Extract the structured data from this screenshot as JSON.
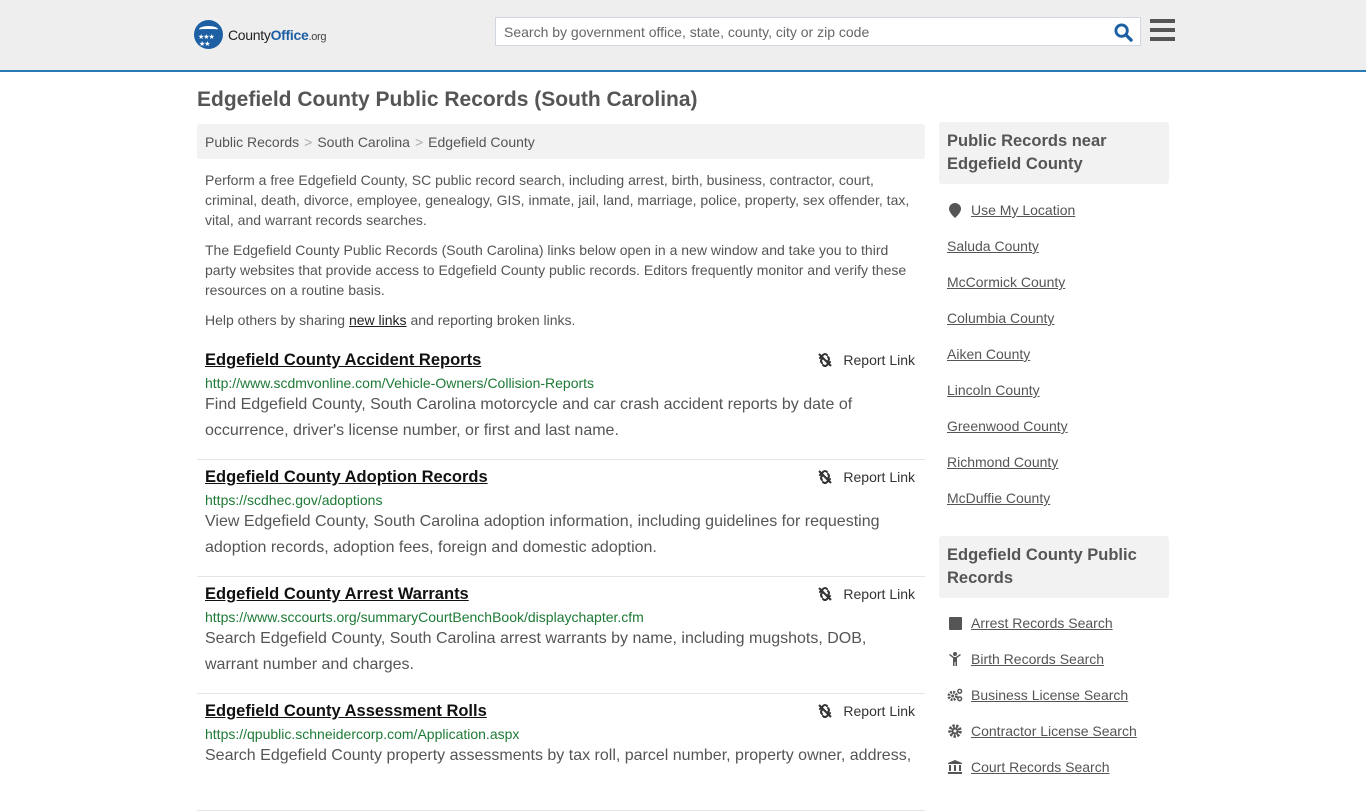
{
  "header": {
    "logo": {
      "county": "County",
      "office": "Office",
      "org": ".org"
    },
    "search": {
      "placeholder": "Search by government office, state, county, city or zip code",
      "value": ""
    }
  },
  "page": {
    "title": "Edgefield County Public Records (South Carolina)",
    "breadcrumb": [
      "Public Records",
      "South Carolina",
      "Edgefield County"
    ],
    "intro1": "Perform a free Edgefield County, SC public record search, including arrest, birth, business, contractor, court, criminal, death, divorce, employee, genealogy, GIS, inmate, jail, land, marriage, police, property, sex offender, tax, vital, and warrant records searches.",
    "intro2": "The Edgefield County Public Records (South Carolina) links below open in a new window and take you to third party websites that provide access to Edgefield County public records. Editors frequently monitor and verify these resources on a routine basis.",
    "help": {
      "before": "Help others by sharing ",
      "link": "new links",
      "after": " and reporting broken links."
    }
  },
  "records": [
    {
      "title": "Edgefield County Accident Reports",
      "url": "http://www.scdmvonline.com/Vehicle-Owners/Collision-Reports",
      "desc": "Find Edgefield County, South Carolina motorcycle and car crash accident reports by date of occurrence, driver's license number, or first and last name.",
      "report": "Report Link"
    },
    {
      "title": "Edgefield County Adoption Records",
      "url": "https://scdhec.gov/adoptions",
      "desc": "View Edgefield County, South Carolina adoption information, including guidelines for requesting adoption records, adoption fees, foreign and domestic adoption.",
      "report": "Report Link"
    },
    {
      "title": "Edgefield County Arrest Warrants",
      "url": "https://www.sccourts.org/summaryCourtBenchBook/displaychapter.cfm",
      "desc": "Search Edgefield County, South Carolina arrest warrants by name, including mugshots, DOB, warrant number and charges.",
      "report": "Report Link"
    },
    {
      "title": "Edgefield County Assessment Rolls",
      "url": "https://qpublic.schneidercorp.com/Application.aspx",
      "desc": "Search Edgefield County property assessments by tax roll, parcel number, property owner, address,",
      "report": "Report Link"
    }
  ],
  "sidebar": {
    "nearby_title": "Public Records near Edgefield County",
    "use_location": "Use My Location",
    "nearby": [
      "Saluda County",
      "McCormick County",
      "Columbia County",
      "Aiken County",
      "Lincoln County",
      "Greenwood County",
      "Richmond County",
      "McDuffie County"
    ],
    "records_title": "Edgefield County Public Records",
    "record_links": [
      {
        "label": "Arrest Records Search",
        "icon": "square-icon"
      },
      {
        "label": "Birth Records Search",
        "icon": "child-icon"
      },
      {
        "label": "Business License Search",
        "icon": "cogs-icon"
      },
      {
        "label": "Contractor License Search",
        "icon": "gear-icon"
      },
      {
        "label": "Court Records Search",
        "icon": "courthouse-icon"
      }
    ]
  }
}
